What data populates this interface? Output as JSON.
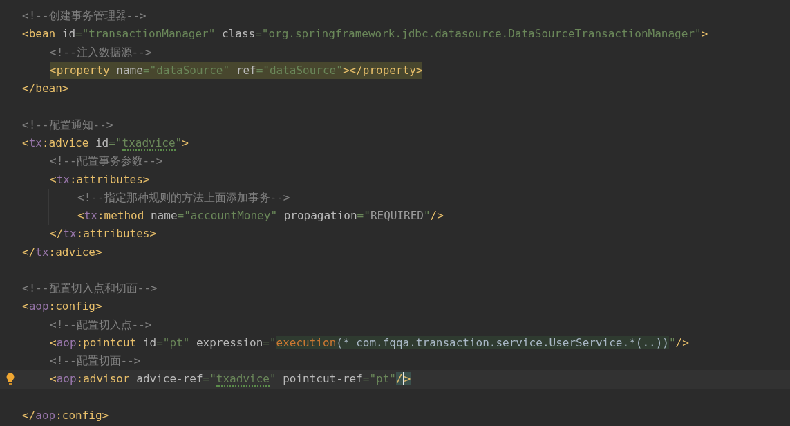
{
  "editor": {
    "lines": [
      {
        "kind": "code",
        "highlighted": false,
        "current": false,
        "tokens": [
          {
            "text": "<!--创建事务管理器-->",
            "kind": "comment"
          }
        ]
      },
      {
        "kind": "code",
        "highlighted": false,
        "current": false,
        "tokens": [
          {
            "text": "<bean",
            "kind": "tag"
          },
          {
            "text": " id",
            "kind": "attr"
          },
          {
            "text": "=\"transactionManager\"",
            "kind": "str"
          },
          {
            "text": " class",
            "kind": "attr"
          },
          {
            "text": "=\"org.springframework.jdbc.datasource.DataSourceTransactionManager\"",
            "kind": "str"
          },
          {
            "text": ">",
            "kind": "tag"
          }
        ],
        "children": [
          {
            "kind": "code",
            "highlighted": false,
            "current": false,
            "tokens": [
              {
                "text": "<!--注入数据源-->",
                "kind": "comment"
              }
            ]
          },
          {
            "kind": "code",
            "highlighted": true,
            "current": false,
            "tokens": [
              {
                "text": "<property",
                "kind": "tag"
              },
              {
                "text": " name",
                "kind": "attr"
              },
              {
                "text": "=\"dataSource\"",
                "kind": "str"
              },
              {
                "text": " ref",
                "kind": "attr"
              },
              {
                "text": "=\"dataSource\"",
                "kind": "str"
              },
              {
                "text": "></property>",
                "kind": "tag"
              }
            ]
          }
        ]
      },
      {
        "kind": "code",
        "highlighted": false,
        "current": false,
        "tokens": [
          {
            "text": "</bean>",
            "kind": "tag"
          }
        ]
      },
      {
        "kind": "blank"
      },
      {
        "kind": "code",
        "highlighted": false,
        "current": false,
        "tokens": [
          {
            "text": "<!--配置通知-->",
            "kind": "comment"
          }
        ]
      },
      {
        "kind": "code",
        "highlighted": false,
        "current": false,
        "tokens": [
          {
            "text": "<",
            "kind": "tag"
          },
          {
            "text": "tx",
            "kind": "ns"
          },
          {
            "text": ":advice",
            "kind": "tag"
          },
          {
            "text": " id",
            "kind": "attr"
          },
          {
            "text": "=\"",
            "kind": "str"
          },
          {
            "text": "txadvice",
            "kind": "str",
            "typo": true
          },
          {
            "text": "\"",
            "kind": "str"
          },
          {
            "text": ">",
            "kind": "tag"
          }
        ],
        "children": [
          {
            "kind": "code",
            "highlighted": false,
            "current": false,
            "tokens": [
              {
                "text": "<!--配置事务参数-->",
                "kind": "comment"
              }
            ]
          },
          {
            "kind": "code",
            "highlighted": false,
            "current": false,
            "tokens": [
              {
                "text": "<",
                "kind": "tag"
              },
              {
                "text": "tx",
                "kind": "ns"
              },
              {
                "text": ":attributes>",
                "kind": "tag"
              }
            ],
            "children": [
              {
                "kind": "code",
                "highlighted": false,
                "current": false,
                "tokens": [
                  {
                    "text": "<!--指定那种规则的方法上面添加事务-->",
                    "kind": "comment"
                  }
                ]
              },
              {
                "kind": "code",
                "highlighted": false,
                "current": false,
                "tokens": [
                  {
                    "text": "<",
                    "kind": "tag"
                  },
                  {
                    "text": "tx",
                    "kind": "ns"
                  },
                  {
                    "text": ":method",
                    "kind": "tag"
                  },
                  {
                    "text": " name",
                    "kind": "attr"
                  },
                  {
                    "text": "=\"accountMoney\"",
                    "kind": "str"
                  },
                  {
                    "text": " propagation",
                    "kind": "attr"
                  },
                  {
                    "text": "=\"",
                    "kind": "str"
                  },
                  {
                    "text": "REQUIRED",
                    "kind": "enum"
                  },
                  {
                    "text": "\"",
                    "kind": "str"
                  },
                  {
                    "text": "/>",
                    "kind": "tag"
                  }
                ]
              }
            ]
          },
          {
            "kind": "code",
            "highlighted": false,
            "current": false,
            "tokens": [
              {
                "text": "</",
                "kind": "tag"
              },
              {
                "text": "tx",
                "kind": "ns"
              },
              {
                "text": ":attributes>",
                "kind": "tag"
              }
            ]
          }
        ]
      },
      {
        "kind": "code",
        "highlighted": false,
        "current": false,
        "tokens": [
          {
            "text": "</",
            "kind": "tag"
          },
          {
            "text": "tx",
            "kind": "ns"
          },
          {
            "text": ":advice>",
            "kind": "tag"
          }
        ]
      },
      {
        "kind": "blank"
      },
      {
        "kind": "code",
        "highlighted": false,
        "current": false,
        "tokens": [
          {
            "text": "<!--配置切入点和切面-->",
            "kind": "comment"
          }
        ]
      },
      {
        "kind": "code",
        "highlighted": false,
        "current": false,
        "tokens": [
          {
            "text": "<",
            "kind": "tag"
          },
          {
            "text": "aop",
            "kind": "ns"
          },
          {
            "text": ":config>",
            "kind": "tag"
          }
        ],
        "children": [
          {
            "kind": "code",
            "highlighted": false,
            "current": false,
            "tokens": [
              {
                "text": "<!--配置切入点-->",
                "kind": "comment"
              }
            ]
          },
          {
            "kind": "code",
            "highlighted": false,
            "current": false,
            "tokens": [
              {
                "text": "<",
                "kind": "tag"
              },
              {
                "text": "aop",
                "kind": "ns"
              },
              {
                "text": ":pointcut",
                "kind": "tag"
              },
              {
                "text": " id",
                "kind": "attr"
              },
              {
                "text": "=\"pt\"",
                "kind": "str"
              },
              {
                "text": " expression",
                "kind": "attr"
              },
              {
                "text": "=\"",
                "kind": "str"
              },
              {
                "text": "execution",
                "kind": "inject-fn"
              },
              {
                "text": "(* com.fqqa.transaction.service.UserService.*(..))",
                "kind": "inject"
              },
              {
                "text": "\"",
                "kind": "str"
              },
              {
                "text": "/>",
                "kind": "tag"
              }
            ]
          },
          {
            "kind": "code",
            "highlighted": false,
            "current": false,
            "tokens": [
              {
                "text": "<!--配置切面-->",
                "kind": "comment"
              }
            ]
          },
          {
            "kind": "code",
            "highlighted": false,
            "current": true,
            "tokens": [
              {
                "text": "<",
                "kind": "tag"
              },
              {
                "text": "aop",
                "kind": "ns"
              },
              {
                "text": ":advisor",
                "kind": "tag"
              },
              {
                "text": " advice-ref",
                "kind": "attr"
              },
              {
                "text": "=\"",
                "kind": "str"
              },
              {
                "text": "txadvice",
                "kind": "str",
                "typo": true
              },
              {
                "text": "\"",
                "kind": "str"
              },
              {
                "text": " pointcut-ref",
                "kind": "attr"
              },
              {
                "text": "=\"pt\"",
                "kind": "str"
              },
              {
                "text": "/",
                "kind": "tag-match",
                "cursor": true
              },
              {
                "text": ">",
                "kind": "tag-match"
              }
            ]
          },
          {
            "kind": "blank"
          }
        ]
      },
      {
        "kind": "code",
        "highlighted": false,
        "current": false,
        "tokens": [
          {
            "text": "</",
            "kind": "tag"
          },
          {
            "text": "aop",
            "kind": "ns"
          },
          {
            "text": ":config>",
            "kind": "tag"
          }
        ]
      }
    ]
  }
}
